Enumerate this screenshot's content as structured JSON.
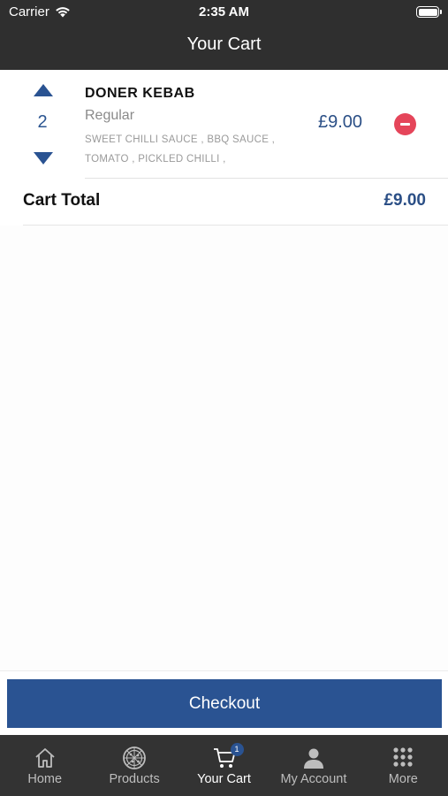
{
  "status_bar": {
    "carrier": "Carrier",
    "time": "2:35 AM"
  },
  "header": {
    "title": "Your Cart"
  },
  "cart": {
    "items": [
      {
        "quantity": "2",
        "name": "DONER KEBAB",
        "size": "Regular",
        "options_line1": "SWEET CHILLI SAUCE , BBQ SAUCE ,",
        "options_line2": "TOMATO , PICKLED CHILLI ,",
        "price": "£9.00"
      }
    ],
    "total_label": "Cart Total",
    "total_value": "£9.00"
  },
  "checkout": {
    "label": "Checkout"
  },
  "tab_bar": {
    "tabs": [
      {
        "label": "Home",
        "icon": "home-icon"
      },
      {
        "label": "Products",
        "icon": "pizza-icon"
      },
      {
        "label": "Your Cart",
        "icon": "cart-icon",
        "badge": "1",
        "active": true
      },
      {
        "label": "My Account",
        "icon": "user-icon"
      },
      {
        "label": "More",
        "icon": "grid-icon"
      }
    ]
  },
  "colors": {
    "header_bg": "#2f2f2f",
    "accent_blue": "#2a5392",
    "remove_red": "#e5455a",
    "tab_bar_bg": "#333333"
  }
}
